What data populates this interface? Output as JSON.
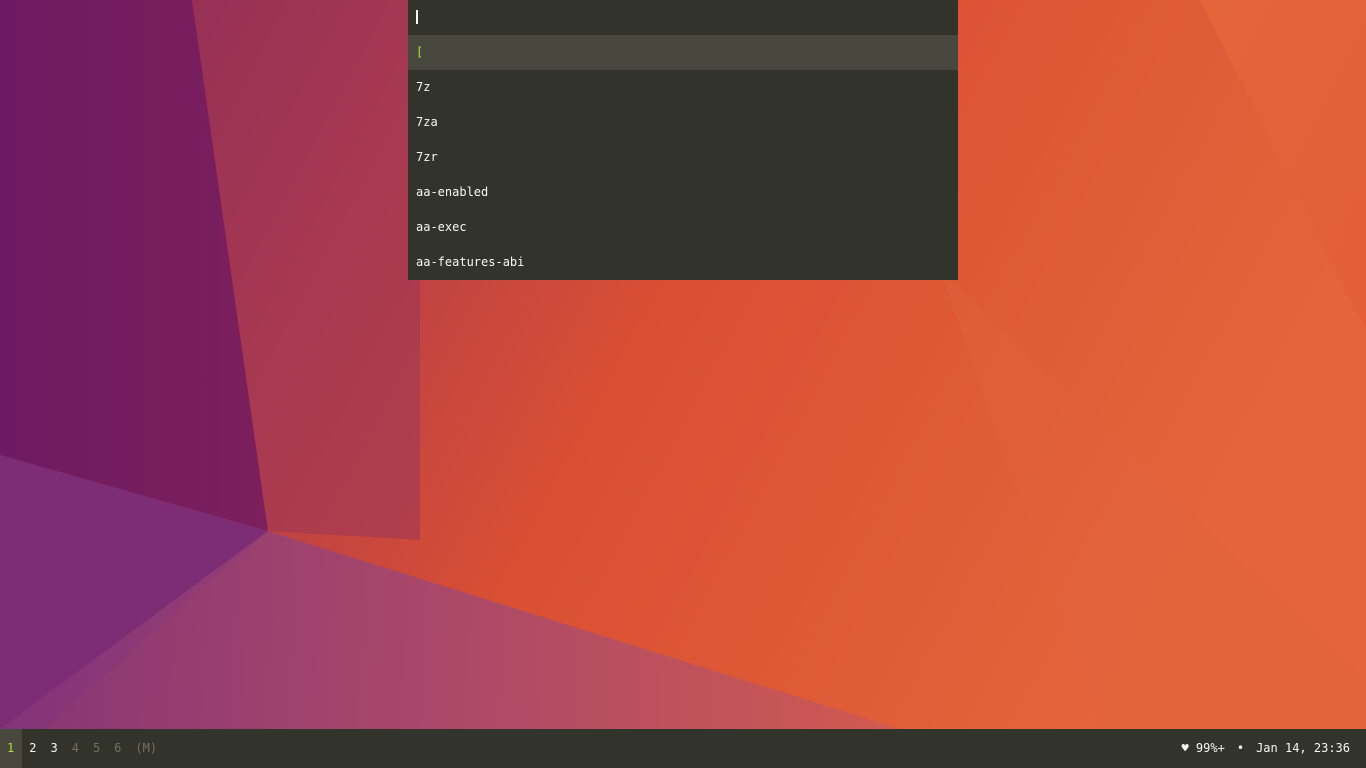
{
  "launcher": {
    "input_value": "",
    "items": [
      {
        "label": "[",
        "selected": true
      },
      {
        "label": "7z",
        "selected": false
      },
      {
        "label": "7za",
        "selected": false
      },
      {
        "label": "7zr",
        "selected": false
      },
      {
        "label": "aa-enabled",
        "selected": false
      },
      {
        "label": "aa-exec",
        "selected": false
      },
      {
        "label": "aa-features-abi",
        "selected": false
      }
    ]
  },
  "bar": {
    "workspaces": [
      {
        "label": "1",
        "state": "active"
      },
      {
        "label": "2",
        "state": "occupied"
      },
      {
        "label": "3",
        "state": "occupied"
      },
      {
        "label": "4",
        "state": "empty"
      },
      {
        "label": "5",
        "state": "empty"
      },
      {
        "label": "6",
        "state": "empty"
      }
    ],
    "mode": "(M)",
    "battery": "♥ 99%+",
    "separator": "•",
    "datetime": "Jan 14, 23:36"
  },
  "colors": {
    "bar_bg": "#32332b",
    "selected_bg": "#49483e",
    "accent_green": "#a6e22e",
    "text": "#f8f8f2",
    "dim_text": "#75715e"
  }
}
